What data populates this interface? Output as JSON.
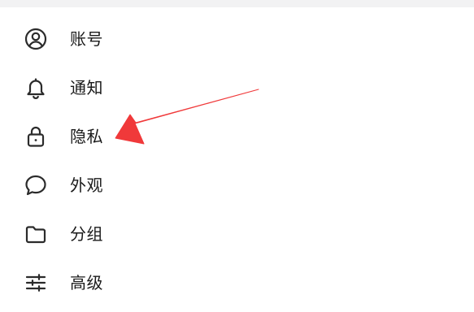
{
  "settings_menu": {
    "items": [
      {
        "label": "账号",
        "icon": "account-icon"
      },
      {
        "label": "通知",
        "icon": "bell-icon"
      },
      {
        "label": "隐私",
        "icon": "lock-icon"
      },
      {
        "label": "外观",
        "icon": "chat-bubble-icon"
      },
      {
        "label": "分组",
        "icon": "folder-icon"
      },
      {
        "label": "高级",
        "icon": "sliders-icon"
      }
    ]
  },
  "colors": {
    "text": "#1a1a1a",
    "icon": "#2b2b2b",
    "arrow": "#f0393a",
    "topbar": "#f2f2f3"
  }
}
